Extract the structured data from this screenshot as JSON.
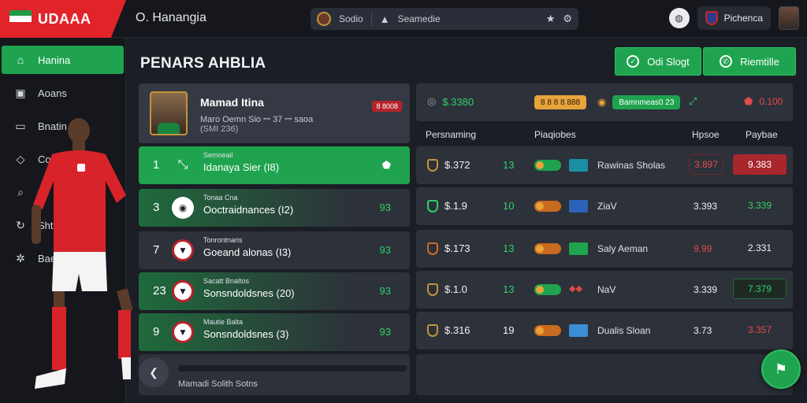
{
  "app": {
    "logo_text": "UDAAA",
    "breadcrumb": "O. Hanangia"
  },
  "search": {
    "left_label": "Sodio",
    "right_label": "Seamedie"
  },
  "top_right": {
    "user_name": "Pichenca"
  },
  "sidebar": {
    "items": [
      {
        "label": "Hanina",
        "icon": "home-icon",
        "active": true
      },
      {
        "label": "Aoans",
        "icon": "calendar-icon",
        "active": false
      },
      {
        "label": "Bnatin",
        "icon": "card-icon",
        "active": false
      },
      {
        "label": "Coan",
        "icon": "diamond-icon",
        "active": false
      },
      {
        "label": "",
        "icon": "search-icon",
        "active": false
      },
      {
        "label": "Shtie",
        "icon": "trend-icon",
        "active": false
      },
      {
        "label": "Bae",
        "icon": "settings-icon",
        "active": false
      }
    ]
  },
  "page": {
    "title": "PENARS AHBLIA"
  },
  "buttons": {
    "primary": "Odi Slogt",
    "secondary": "Riemtille"
  },
  "profile": {
    "name": "Mamad Itina",
    "line1": "Maro Oemn Sio ꟷ 37 ꟷ saoa",
    "line2": "(SMI 236)",
    "tag": "8 8008"
  },
  "list_rows": [
    {
      "num": "1",
      "small": "Semoeail",
      "label": "Idanaya Sier (I8)",
      "value": ""
    },
    {
      "num": "3",
      "small": "Tonaa Cna",
      "label": "Ooctraidnances (I2)",
      "value": "93"
    },
    {
      "num": "7",
      "small": "Tonrontnaris",
      "label": "Goeand alonas (I3)",
      "value": "93"
    },
    {
      "num": "23",
      "small": "Sacatt Bnaltos",
      "label": "Sonsndoldsnes (20)",
      "value": "93"
    },
    {
      "num": "9",
      "small": "Mautie Balta",
      "label": "Sonsndoldsnes (3)",
      "value": "93"
    }
  ],
  "list_footer": {
    "text": "Mamadi Solith Sotns"
  },
  "stats_top": {
    "price": "$.3380",
    "pill1": "8 8 8 8 888",
    "pill2": "Bamnmeas0 23",
    "alert": "0.100"
  },
  "stats_headers": {
    "c1": "Persnaming",
    "c2": "Piaqiobes",
    "c3": "Hpsoe",
    "c4": "Paybae"
  },
  "stat_rows": [
    {
      "price": "$.372",
      "count": "13",
      "name": "Rawinas Sholas",
      "v1": "3.897",
      "v2": "9.383",
      "v1_color": "#e24a4a",
      "v2_style": "red"
    },
    {
      "price": "$.1.9",
      "count": "10",
      "name": "ZiaV",
      "v1": "3.393",
      "v2": "3.339",
      "v1_color": "#f1f2f4",
      "v2_style": "green-text"
    },
    {
      "price": "$.173",
      "count": "13",
      "name": "Saly Aeman",
      "v1": "9.99",
      "v2": "2.331",
      "v1_color": "#e24a4a",
      "v2_style": "plain"
    },
    {
      "price": "$.1.0",
      "count": "13",
      "name": "NaV",
      "v1": "3.339",
      "v2": "7.379",
      "v1_color": "#f1f2f4",
      "v2_style": "green-box"
    },
    {
      "price": "$.316",
      "count": "19",
      "name": "Dualis Sloan",
      "v1": "3.73",
      "v2": "3.357",
      "v1_color": "#f1f2f4",
      "v2_style": "red-text"
    }
  ],
  "colors": {
    "accent": "#1fa34f",
    "brand_red": "#e0242a",
    "bg": "#1b1e25"
  }
}
